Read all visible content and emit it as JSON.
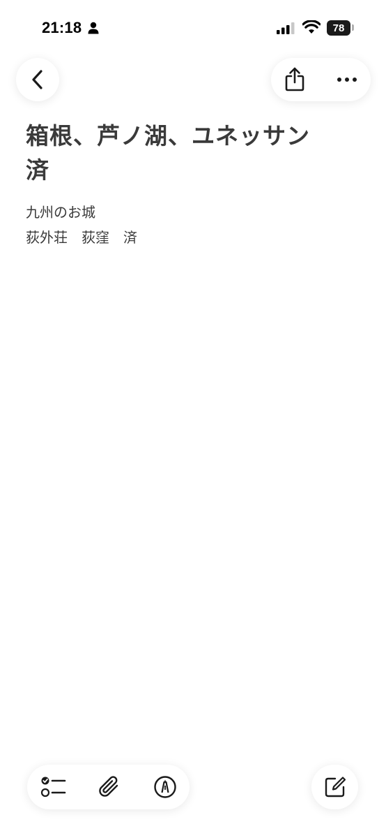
{
  "status_bar": {
    "time": "21:18",
    "battery_level": "78",
    "icons": [
      "person-icon",
      "cellular-signal-icon",
      "wifi-icon",
      "battery-icon"
    ]
  },
  "nav": {
    "back_icon": "chevron-left-icon",
    "share_icon": "share-icon",
    "more_icon": "ellipsis-icon"
  },
  "note": {
    "title": "箱根、芦ノ湖、ユネッサン　済",
    "lines": [
      "九州のお城",
      "荻外荘　荻窪　済"
    ]
  },
  "toolbar": {
    "icons": [
      "checklist-icon",
      "paperclip-icon",
      "markup-pen-icon",
      "compose-icon"
    ]
  },
  "colors": {
    "text": "#3a3a3a",
    "background": "#ffffff",
    "icon": "#1a1a1a"
  }
}
